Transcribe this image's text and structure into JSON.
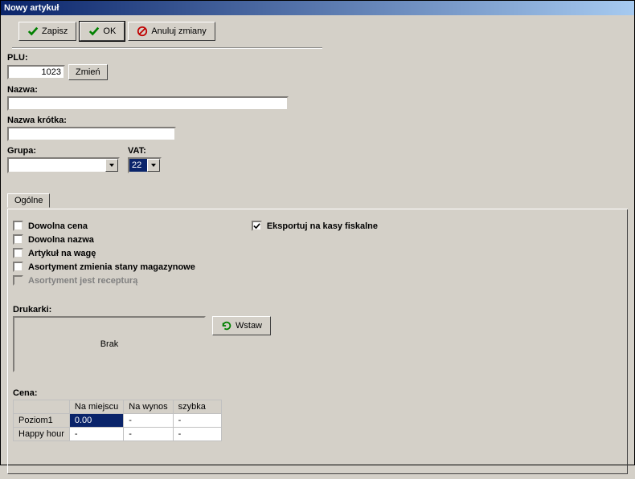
{
  "title": "Nowy artykuł",
  "toolbar": {
    "save": "Zapisz",
    "ok": "OK",
    "cancel": "Anuluj zmiany"
  },
  "fields": {
    "plu_label": "PLU:",
    "plu_value": "1023",
    "plu_change": "Zmień",
    "name_label": "Nazwa:",
    "name_value": "",
    "short_name_label": "Nazwa krótka:",
    "short_name_value": "",
    "group_label": "Grupa:",
    "group_value": "",
    "vat_label": "VAT:",
    "vat_value": "22"
  },
  "tab": {
    "general": "Ogólne"
  },
  "checks": {
    "any_price": "Dowolna cena",
    "any_name": "Dowolna nazwa",
    "by_weight": "Artykuł na wagę",
    "stock_change": "Asortyment zmienia stany magazynowe",
    "is_recipe": "Asortyment jest recepturą",
    "export_fiscal": "Eksportuj na kasy fiskalne"
  },
  "printers": {
    "label": "Drukarki:",
    "none": "Brak",
    "insert": "Wstaw"
  },
  "price": {
    "label": "Cena:",
    "headers": [
      "",
      "Na miejscu",
      "Na wynos",
      "szybka"
    ],
    "rows": [
      {
        "label": "Poziom1",
        "cells": [
          "0.00",
          "-",
          "-"
        ]
      },
      {
        "label": "Happy hour",
        "cells": [
          "-",
          "-",
          "-"
        ]
      }
    ]
  }
}
